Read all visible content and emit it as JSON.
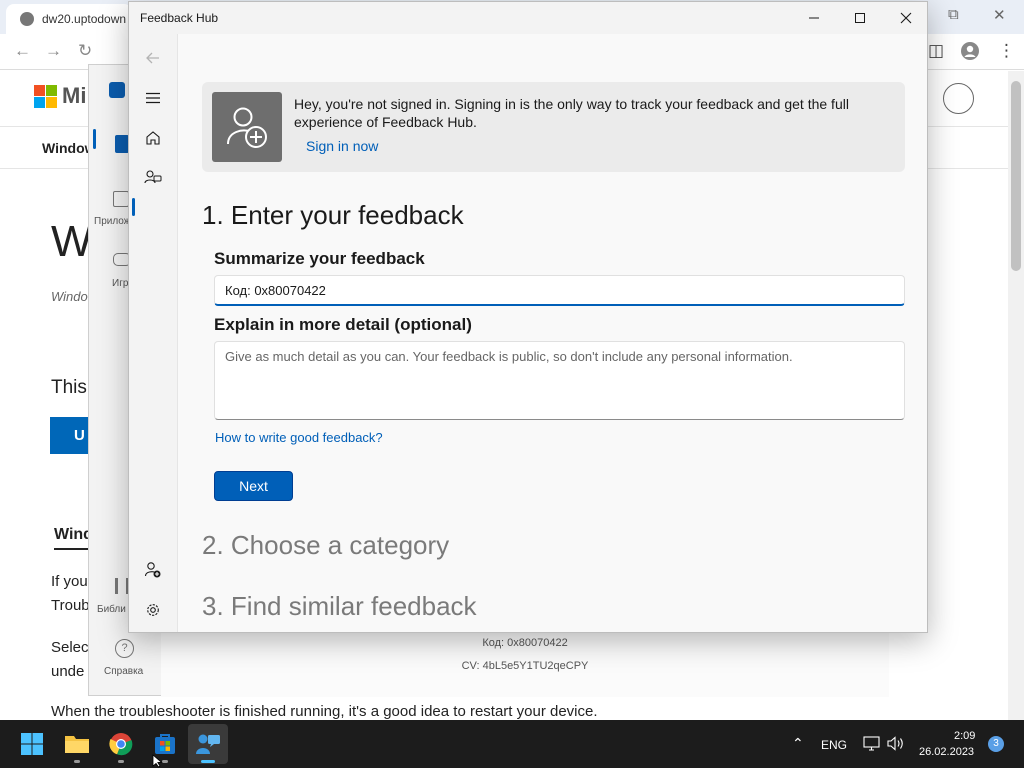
{
  "browser": {
    "tab_title": "dw20.uptodown",
    "brand_text": "Mi",
    "nav_item": "Window",
    "heading_fragment": "W",
    "subtitle_fragment": "Windo",
    "body_fragment_1": "This",
    "button_fragment": "U",
    "tab_fragment": "Wind",
    "para_fragment_1": "If you",
    "para_fragment_2": "Troub",
    "para_fragment_3": "Selec",
    "para_fragment_4": "unde",
    "footer_sentence": "When the troubleshooter is finished running, it's a good idea to restart your device."
  },
  "store": {
    "side_items": {
      "apps": "Прилож",
      "games": "Игр",
      "library": "Библи",
      "help": "Справка"
    },
    "code_line": "Код: 0x80070422",
    "cv_line": "CV: 4bL5e5Y1TU2qeCPY"
  },
  "feedback_hub": {
    "title": "Feedback Hub",
    "banner": {
      "message": "Hey, you're not signed in. Signing in is the only way to track your feedback and get the full experience of Feedback Hub.",
      "sign_in_link": "Sign in now"
    },
    "steps": {
      "step1": "1. Enter your feedback",
      "step2": "2. Choose a category",
      "step3": "3. Find similar feedback"
    },
    "summary": {
      "label": "Summarize your feedback",
      "value": "Код: 0x80070422"
    },
    "detail": {
      "label": "Explain in more detail (optional)",
      "placeholder": "Give as much detail as you can. Your feedback is public, so don't include any personal information."
    },
    "help_link": "How to write good feedback?",
    "next_label": "Next"
  },
  "taskbar": {
    "language": "ENG",
    "time": "2:09",
    "date": "26.02.2023",
    "notification_count": "3"
  },
  "colors": {
    "accent": "#005fb8",
    "taskbar": "#1c1c1c"
  }
}
